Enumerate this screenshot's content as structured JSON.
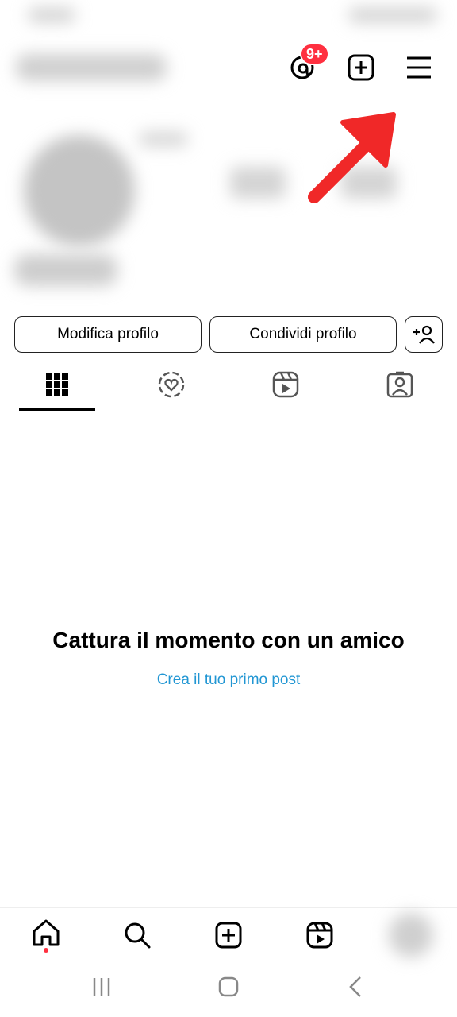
{
  "header": {
    "threads_badge": "9+",
    "icons": [
      "threads-icon",
      "create-post-icon",
      "hamburger-menu-icon"
    ]
  },
  "actions": {
    "edit_profile": "Modifica profilo",
    "share_profile": "Condividi profilo"
  },
  "tabs": [
    {
      "name": "grid",
      "icon": "grid-icon",
      "selected": true
    },
    {
      "name": "remix",
      "icon": "heart-circle-icon",
      "selected": false
    },
    {
      "name": "reels",
      "icon": "reels-icon",
      "selected": false
    },
    {
      "name": "tagged",
      "icon": "tagged-person-icon",
      "selected": false
    }
  ],
  "empty_state": {
    "title": "Cattura il momento con un amico",
    "link": "Crea il tuo primo post"
  },
  "bottom_nav": [
    "home-icon",
    "search-icon",
    "create-icon",
    "reels-icon",
    "profile-avatar"
  ],
  "colors": {
    "badge": "#ff3040",
    "link": "#2196d3",
    "annotation_arrow": "#f02828"
  }
}
